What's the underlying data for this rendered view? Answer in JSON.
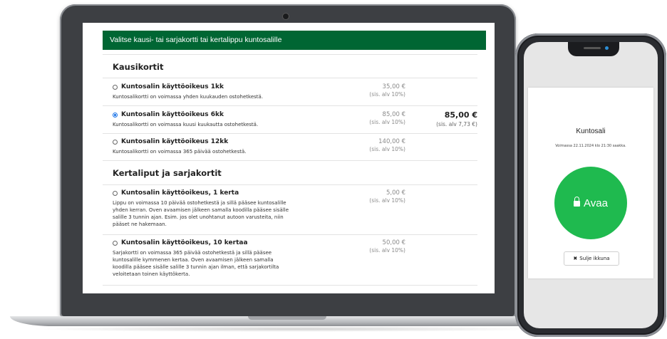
{
  "page": {
    "header": "Valitse kausi- tai sarjakortti tai kertalippu kuntosalille"
  },
  "sections": [
    {
      "title": "Kausikortit",
      "items": [
        {
          "name": "Kuntosalin käyttöoikeus 1kk",
          "desc": "Kuntosalikortti on voimassa yhden kuukauden ostohetkestä.",
          "price": "35,00 €",
          "vat": "(sis. alv 10%)",
          "selected": false
        },
        {
          "name": "Kuntosalin käyttöoikeus 6kk",
          "desc": "Kuntosalikortti on voimassa kuusi kuukautta ostohetkestä.",
          "price": "85,00 €",
          "vat": "(sis. alv 10%)",
          "selected": true
        },
        {
          "name": "Kuntosalin käyttöoikeus 12kk",
          "desc": "Kuntosalikortti on voimassa 365 päivää ostohetkestä.",
          "price": "140,00 €",
          "vat": "(sis. alv 10%)",
          "selected": false
        }
      ]
    },
    {
      "title": "Kertaliput ja sarjakortit",
      "items": [
        {
          "name": "Kuntosalin käyttöoikeus, 1 kerta",
          "desc": "Lippu on voimassa 10 päivää ostohetkestä ja sillä pääsee kuntosalille yhden kerran. Oven avaamisen jälkeen samalla koodilla pääsee sisälle salille 3 tunnin ajan. Esim. jos olet unohtanut autoon varusteita, niin pääset ne hakemaan.",
          "price": "5,00 €",
          "vat": "(sis. alv 10%)",
          "selected": false
        },
        {
          "name": "Kuntosalin käyttöoikeus, 10 kertaa",
          "desc": "Sarjakortti on voimassa 365 päivää ostohetkestä ja sillä pääsee kuntosalille kymmenen kertaa. Oven avaamisen jälkeen samalla koodilla pääsee sisälle salille 3 tunnin ajan ilman, että sarjakortilta veloitetaan toinen käyttökerta.",
          "price": "50,00 €",
          "vat": "(sis. alv 10%)",
          "selected": false
        }
      ]
    }
  ],
  "total": {
    "amount": "85,00 €",
    "vat": "(sis. alv 7,73 €)"
  },
  "phone": {
    "title": "Kuntosali",
    "valid_text": "Voimassa 22.11.2024 klo 21:30 saakka.",
    "open_label": "Avaa",
    "close_label": "Sulje ikkuna",
    "icons": {
      "open": "lock-icon",
      "close": "x-icon"
    }
  },
  "colors": {
    "header": "#006633",
    "open_button": "#1fba4f",
    "radio_selected": "#1a73e8"
  }
}
